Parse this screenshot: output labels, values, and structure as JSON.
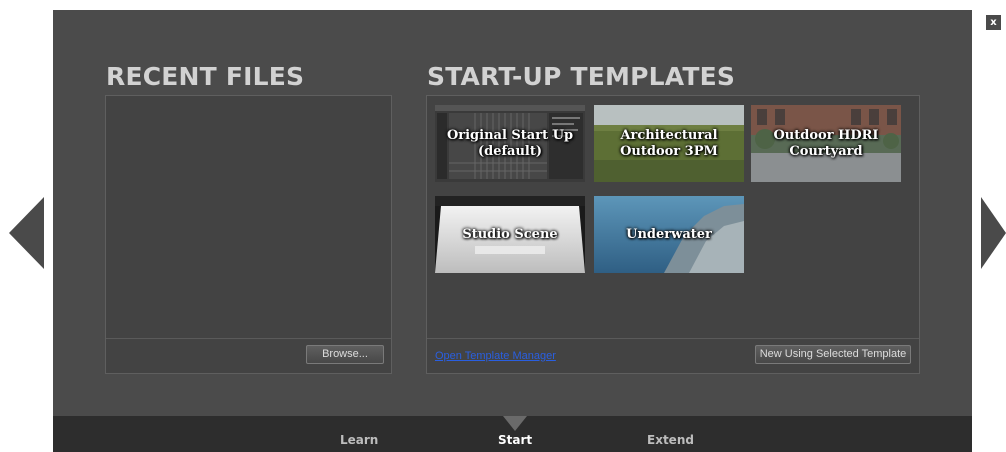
{
  "close_label": "x",
  "recent": {
    "title": "RECENT FILES",
    "browse_label": "Browse..."
  },
  "templates": {
    "title": "START-UP TEMPLATES",
    "items": [
      {
        "label_line1": "Original Start Up",
        "label_line2": "(default)"
      },
      {
        "label_line1": "Architectural",
        "label_line2": "Outdoor 3PM"
      },
      {
        "label_line1": "Outdoor HDRI",
        "label_line2": "Courtyard"
      },
      {
        "label_line1": "Studio Scene",
        "label_line2": ""
      },
      {
        "label_line1": "Underwater",
        "label_line2": ""
      }
    ],
    "manager_link": "Open Template Manager",
    "new_button": "New Using Selected Template"
  },
  "nav": {
    "learn": "Learn",
    "start": "Start",
    "extend": "Extend",
    "active": "Start"
  },
  "colors": {
    "dialog_bg": "#4b4b4b",
    "bottom_bar": "#2d2d2d",
    "link": "#2a5fe0"
  }
}
